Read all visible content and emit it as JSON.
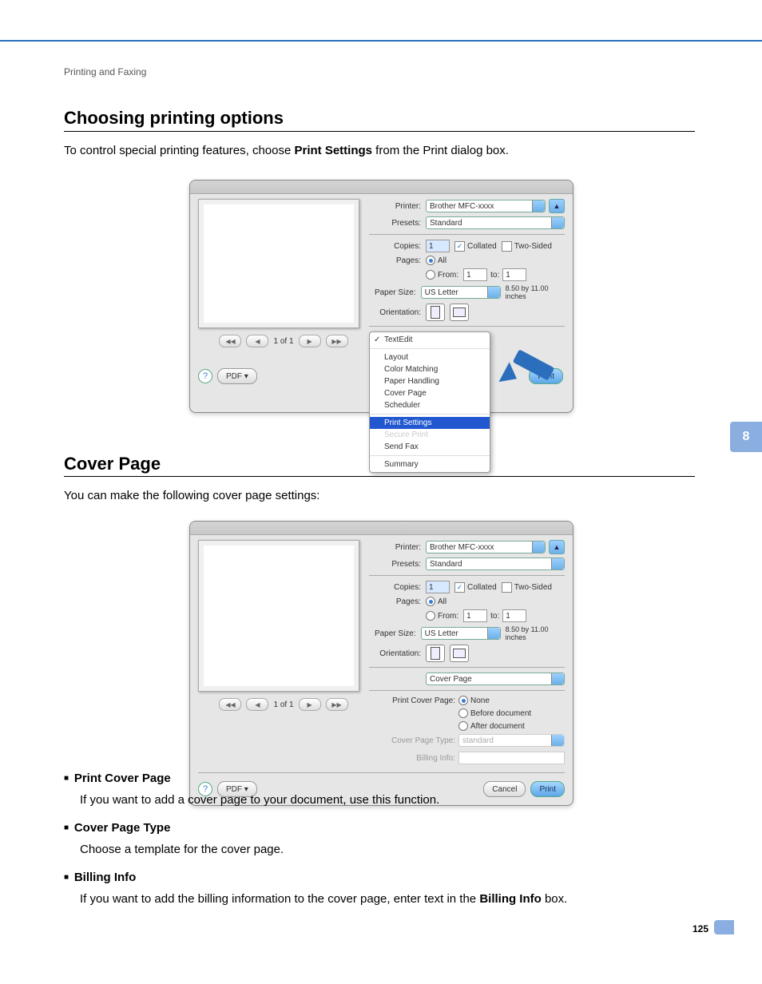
{
  "breadcrumb": "Printing and Faxing",
  "heading1": "Choosing printing options",
  "para1_a": "To control special printing features, choose ",
  "para1_b": "Print Settings",
  "para1_c": " from the Print dialog box.",
  "heading2": "Cover Page",
  "para2": "You can make the following cover page settings:",
  "sidetab": "8",
  "pagenum": "125",
  "bullets": [
    {
      "title": "Print Cover Page",
      "body": "If you want to add a cover page to your document, use this function."
    },
    {
      "title": "Cover Page Type",
      "body": "Choose a template for the cover page."
    },
    {
      "title": "Billing Info",
      "body_a": "If you want to add the billing information to the cover page, enter text in the ",
      "body_b": "Billing Info",
      "body_c": " box."
    }
  ],
  "dlg": {
    "printer_label": "Printer:",
    "printer_value": "Brother MFC-xxxx",
    "presets_label": "Presets:",
    "presets_value": "Standard",
    "copies_label": "Copies:",
    "copies_value": "1",
    "collated_label": "Collated",
    "twosided_label": "Two-Sided",
    "pages_label": "Pages:",
    "pages_all": "All",
    "pages_from": "From:",
    "pages_from_val": "1",
    "pages_to": "to:",
    "pages_to_val": "1",
    "papersize_label": "Paper Size:",
    "papersize_value": "US Letter",
    "papersize_dim": "8.50 by 11.00 inches",
    "orientation_label": "Orientation:",
    "nav": "1 of 1",
    "pdf_label": "PDF ▾",
    "help": "?",
    "print_label": "Print",
    "cancel_label": "Cancel",
    "panel_combo": "Cover Page",
    "cp_label": "Print Cover Page:",
    "cp_none": "None",
    "cp_before": "Before document",
    "cp_after": "After document",
    "cp_type_label": "Cover Page Type:",
    "cp_type_value": "standard",
    "billing_label": "Billing Info:",
    "dropdown": {
      "textedit": "TextEdit",
      "items": [
        "Layout",
        "Color Matching",
        "Paper Handling",
        "Cover Page",
        "Scheduler"
      ],
      "print_settings": "Print Settings",
      "items2": [
        "Secure Print",
        "Send Fax"
      ],
      "summary": "Summary"
    }
  }
}
